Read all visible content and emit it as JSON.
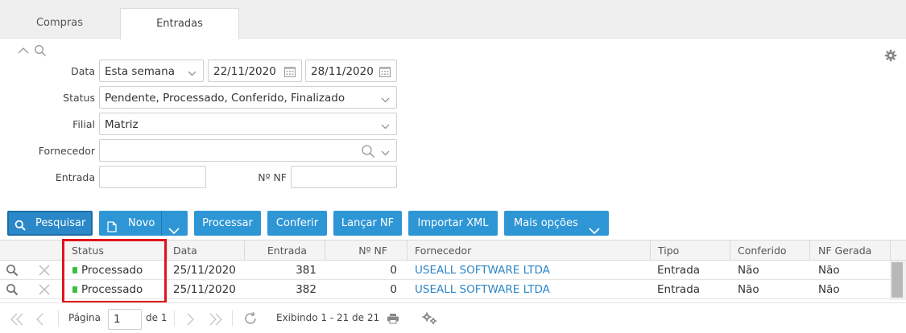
{
  "tabs": [
    {
      "label": "Compras",
      "active": false
    },
    {
      "label": "Entradas",
      "active": true
    }
  ],
  "filters": {
    "data_label": "Data",
    "data_period": "Esta semana",
    "date_from": "22/11/2020",
    "date_to": "28/11/2020",
    "status_label": "Status",
    "status_value": "Pendente, Processado, Conferido, Finalizado",
    "filial_label": "Filial",
    "filial_value": "Matriz",
    "fornecedor_label": "Fornecedor",
    "fornecedor_value": "",
    "entrada_label": "Entrada",
    "entrada_value": "",
    "nf_label": "Nº NF",
    "nf_value": ""
  },
  "toolbar": {
    "pesquisar": "Pesquisar",
    "novo": "Novo",
    "processar": "Processar",
    "conferir": "Conferir",
    "lancar_nf": "Lançar NF",
    "importar_xml": "Importar XML",
    "mais_opcoes": "Mais opções"
  },
  "grid": {
    "columns": {
      "status": "Status",
      "data": "Data",
      "entrada": "Entrada",
      "nf": "Nº NF",
      "fornecedor": "Fornecedor",
      "tipo": "Tipo",
      "conferido": "Conferido",
      "nf_gerada": "NF Gerada"
    },
    "rows": [
      {
        "status": "Processado",
        "data": "25/11/2020",
        "entrada": "381",
        "nf": "0",
        "fornecedor": "USEALL SOFTWARE LTDA",
        "tipo": "Entrada",
        "conferido": "Não",
        "nf_gerada": "Não"
      },
      {
        "status": "Processado",
        "data": "25/11/2020",
        "entrada": "382",
        "nf": "0",
        "fornecedor": "USEALL SOFTWARE LTDA",
        "tipo": "Entrada",
        "conferido": "Não",
        "nf_gerada": "Não"
      }
    ],
    "status_color": "#3cbf3c"
  },
  "pager": {
    "page_label": "Página",
    "page_value": "1",
    "of_label": "de 1",
    "exibindo": "Exibindo 1 - 21 de 21"
  },
  "colors": {
    "accent": "#2f96d6",
    "highlight": "#e0141c",
    "link": "#2f86c6"
  }
}
